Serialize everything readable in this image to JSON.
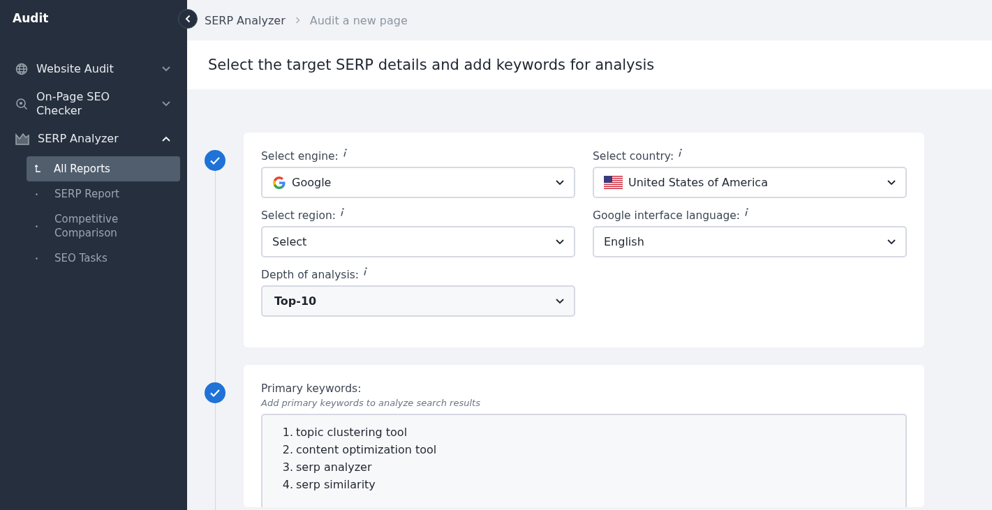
{
  "sidebar": {
    "title": "Audit",
    "items": [
      {
        "label": "Website Audit",
        "kind": "globe",
        "expanded": false
      },
      {
        "label": "On-Page SEO Checker",
        "kind": "search",
        "expanded": false
      },
      {
        "label": "SERP Analyzer",
        "kind": "chart",
        "expanded": true,
        "children": [
          {
            "label": "All Reports",
            "selected": true
          },
          {
            "label": "SERP Report",
            "selected": false
          },
          {
            "label": "Competitive Comparison",
            "selected": false
          },
          {
            "label": "SEO Tasks",
            "selected": false
          }
        ]
      }
    ]
  },
  "breadcrumb": [
    "SERP Analyzer",
    "Audit a new page"
  ],
  "page_title": "Select the target SERP details and add keywords for analysis",
  "steps": [
    {
      "done": true,
      "fields": [
        {
          "label": "Select engine:",
          "value": "Google",
          "kind": "google",
          "highlighted": false
        },
        {
          "label": "Select country:",
          "value": "United States of America",
          "kind": "flag",
          "highlighted": false
        },
        {
          "label": "Select region:",
          "value": "Select",
          "highlighted": false
        },
        {
          "label": "Google interface language:",
          "value": "English",
          "highlighted": false
        },
        {
          "label": "Depth of analysis:",
          "value": "Top-10",
          "highlighted": true
        }
      ]
    },
    {
      "done": true,
      "label": "Primary keywords:",
      "hint": "Add primary keywords to analyze search results",
      "keywords": [
        {
          "number": "1.",
          "text": "topic clustering tool"
        },
        {
          "number": "2.",
          "text": "content optimization tool"
        },
        {
          "number": "3.",
          "text": "serp analyzer"
        },
        {
          "number": "4.",
          "text": "serp similarity"
        }
      ]
    }
  ]
}
